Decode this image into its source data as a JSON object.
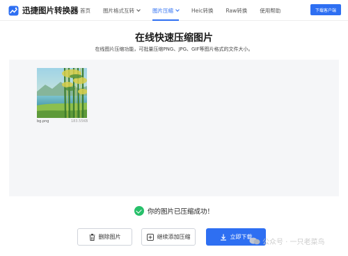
{
  "header": {
    "logo_text": "迅捷图片转换器",
    "nav": [
      {
        "label": "首页",
        "active": false,
        "has_dropdown": false
      },
      {
        "label": "图片格式互转",
        "active": false,
        "has_dropdown": true
      },
      {
        "label": "图片压缩",
        "active": true,
        "has_dropdown": true
      },
      {
        "label": "Heic转换",
        "active": false,
        "has_dropdown": false
      },
      {
        "label": "Raw转换",
        "active": false,
        "has_dropdown": false
      },
      {
        "label": "使用帮助",
        "active": false,
        "has_dropdown": false
      }
    ],
    "download_label": "下载客户端"
  },
  "page": {
    "title": "在线快速压缩图片",
    "subtitle": "在线图片压缩功能，可批量压缩PNG、JPG、GIF等图片格式的文件大小。"
  },
  "file": {
    "name": "bg.png",
    "size": "183.55KB"
  },
  "status": {
    "message": "你的图片已压缩成功！"
  },
  "actions": {
    "delete_label": "删除图片",
    "add_label": "继续添加压缩",
    "download_label": "立即下载"
  },
  "watermark": {
    "text": "公众号 · 一只老菜鸟"
  },
  "colors": {
    "accent": "#2e6ff2",
    "success": "#27c06a",
    "workspace_bg": "#f5f6f8"
  }
}
